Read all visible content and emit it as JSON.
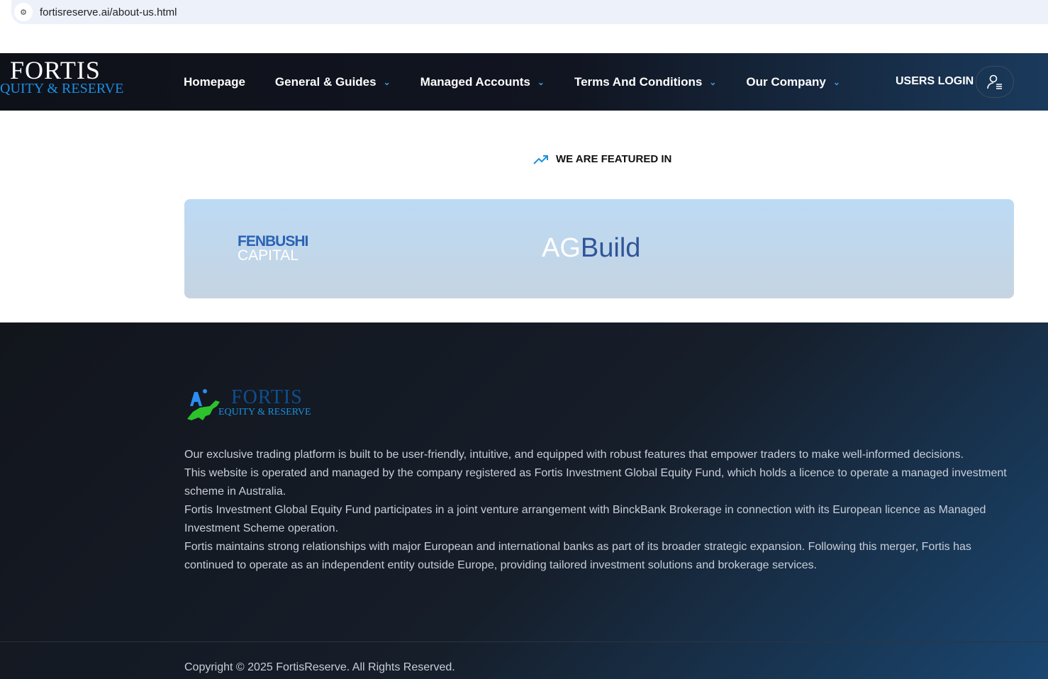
{
  "browser": {
    "url": "fortisreserve.ai/about-us.html"
  },
  "header": {
    "logo_line1": "FORTIS",
    "logo_line2": "QUITY & RESERVE",
    "menu": [
      {
        "label": "Homepage"
      },
      {
        "label": "General & Guides"
      },
      {
        "label": "Managed Accounts"
      },
      {
        "label": "Terms And Conditions"
      },
      {
        "label": "Our Company"
      }
    ],
    "login_label": "USERS LOGIN"
  },
  "featured": {
    "title": "WE ARE FEATURED IN",
    "logos": [
      {
        "line1": "FENBUSHI",
        "line2": "CAPITAL"
      },
      {
        "part1": "AG",
        "part2": "Build"
      }
    ]
  },
  "footer": {
    "logo_line1": "FORTIS",
    "logo_line2": "EQUITY & RESERVE",
    "paragraphs": [
      "Our exclusive trading platform is built to be user-friendly, intuitive, and equipped with robust features that empower traders to make well-informed decisions.",
      "This website is operated and managed by the company registered as Fortis Investment Global Equity Fund, which holds a licence to operate a managed investment scheme in Australia.",
      "Fortis Investment Global Equity Fund participates in a joint venture arrangement with BinckBank Brokerage in connection with its European licence as Managed Investment Scheme operation.",
      "Fortis maintains strong relationships with major European and international banks as part of its broader strategic expansion. Following this merger, Fortis has continued to operate as an independent entity outside Europe, providing tailored investment solutions and brokerage services."
    ],
    "copyright": "Copyright © 2025 FortisReserve. All Rights Reserved."
  }
}
